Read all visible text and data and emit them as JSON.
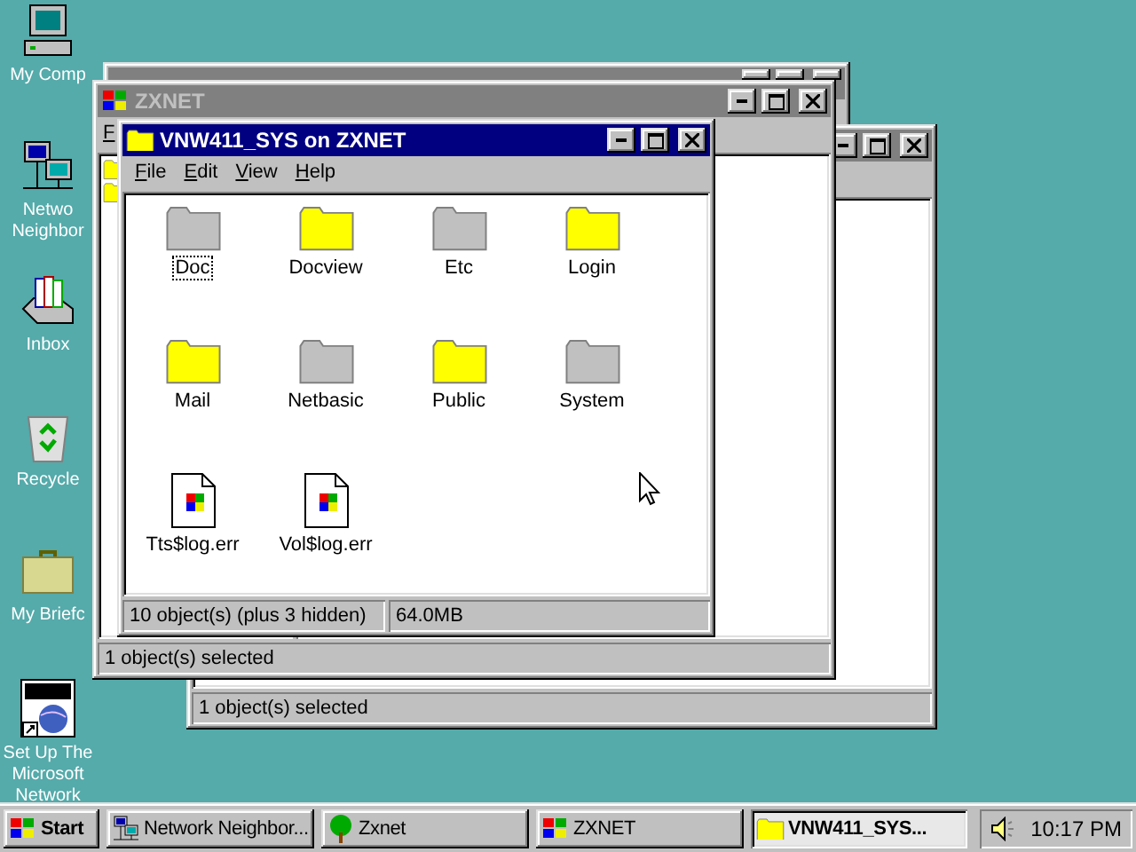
{
  "desktop_icons": [
    {
      "kind": "computer",
      "label_lines": [
        "My Comp"
      ]
    },
    {
      "kind": "network",
      "label_lines": [
        "Netwo",
        "Neighbor"
      ]
    },
    {
      "kind": "inbox",
      "label_lines": [
        "Inbox"
      ]
    },
    {
      "kind": "recycle",
      "label_lines": [
        "Recycle"
      ]
    },
    {
      "kind": "briefcase",
      "label_lines": [
        "My Briefc"
      ]
    },
    {
      "kind": "msn",
      "label_lines": [
        "Set Up The",
        "Microsoft",
        "Network"
      ]
    }
  ],
  "back_window": {
    "active": false
  },
  "network_window": {
    "active": false,
    "status": "1 object(s) selected"
  },
  "zxnet_window": {
    "title": "ZXNET",
    "active": false,
    "menu": [
      "F"
    ],
    "status": "1 object(s) selected"
  },
  "folder_window": {
    "title": "VNW411_SYS on ZXNET",
    "active": true,
    "menu": [
      "File",
      "Edit",
      "View",
      "Help"
    ],
    "items": [
      {
        "label": "Doc",
        "kind": "folder",
        "color": "#c0c0c0",
        "focused": true
      },
      {
        "label": "Docview",
        "kind": "folder",
        "color": "#ffff00",
        "focused": false
      },
      {
        "label": "Etc",
        "kind": "folder",
        "color": "#c0c0c0",
        "focused": false
      },
      {
        "label": "Login",
        "kind": "folder",
        "color": "#ffff00",
        "focused": false
      },
      {
        "label": "Mail",
        "kind": "folder",
        "color": "#ffff00",
        "focused": false
      },
      {
        "label": "Netbasic",
        "kind": "folder",
        "color": "#c0c0c0",
        "focused": false
      },
      {
        "label": "Public",
        "kind": "folder",
        "color": "#ffff00",
        "focused": false
      },
      {
        "label": "System",
        "kind": "folder",
        "color": "#c0c0c0",
        "focused": false
      },
      {
        "label": "Tts$log.err",
        "kind": "file",
        "focused": false
      },
      {
        "label": "Vol$log.err",
        "kind": "file",
        "focused": false
      }
    ],
    "status": [
      "10 object(s) (plus 3 hidden)",
      "64.0MB"
    ]
  },
  "taskbar": {
    "start": "Start",
    "buttons": [
      {
        "label": "Network Neighbor...",
        "kind": "network",
        "selected": false
      },
      {
        "label": "Zxnet",
        "kind": "tree",
        "selected": false
      },
      {
        "label": "ZXNET",
        "kind": "app",
        "selected": false
      },
      {
        "label": "VNW411_SYS...",
        "kind": "folder",
        "selected": true
      }
    ],
    "clock": "10:17 PM"
  }
}
